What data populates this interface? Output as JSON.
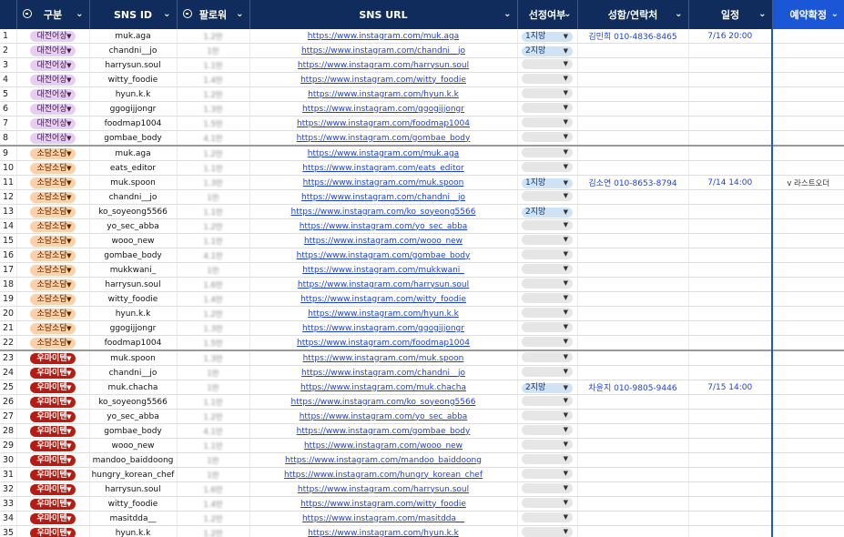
{
  "headers": {
    "category": "구분",
    "sns_id": "SNS ID",
    "followers": "팔로워",
    "url": "SNS URL",
    "selection": "선정여부",
    "contact": "성함/연락처",
    "schedule": "일정",
    "confirm": "예약확정"
  },
  "rows": [
    {
      "no": "1",
      "cat": "대전어상",
      "grp": "a",
      "id": "muk.aga",
      "fol": "1.2만",
      "url": "https://www.instagram.com/muk.aga",
      "sel": "1지망",
      "contact": "김민희 010-4836-8465",
      "date": "7/16 20:00",
      "confirm": ""
    },
    {
      "no": "2",
      "cat": "대전어상",
      "grp": "a",
      "id": "chandni__jo",
      "fol": "1만",
      "url": "https://www.instagram.com/chandni__jo",
      "sel": "2지망",
      "contact": "",
      "date": "",
      "confirm": ""
    },
    {
      "no": "3",
      "cat": "대전어상",
      "grp": "a",
      "id": "harrysun.soul",
      "fol": "1.1만",
      "url": "https://www.instagram.com/harrysun.soul",
      "sel": "",
      "contact": "",
      "date": "",
      "confirm": ""
    },
    {
      "no": "4",
      "cat": "대전어상",
      "grp": "a",
      "id": "witty_foodie",
      "fol": "1.4만",
      "url": "https://www.instagram.com/witty_foodie",
      "sel": "",
      "contact": "",
      "date": "",
      "confirm": ""
    },
    {
      "no": "5",
      "cat": "대전어상",
      "grp": "a",
      "id": "hyun.k.k",
      "fol": "1.2만",
      "url": "https://www.instagram.com/hyun.k.k",
      "sel": "",
      "contact": "",
      "date": "",
      "confirm": ""
    },
    {
      "no": "6",
      "cat": "대전어상",
      "grp": "a",
      "id": "ggogijjongr",
      "fol": "1.3만",
      "url": "https://www.instagram.com/ggogijjongr",
      "sel": "",
      "contact": "",
      "date": "",
      "confirm": ""
    },
    {
      "no": "7",
      "cat": "대전어상",
      "grp": "a",
      "id": "foodmap1004",
      "fol": "1.5만",
      "url": "https://www.instagram.com/foodmap1004",
      "sel": "",
      "contact": "",
      "date": "",
      "confirm": ""
    },
    {
      "no": "8",
      "cat": "대전어상",
      "grp": "a",
      "id": "gombae_body",
      "fol": "4.1만",
      "url": "https://www.instagram.com/gombae_body",
      "sel": "",
      "contact": "",
      "date": "",
      "confirm": ""
    },
    {
      "no": "9",
      "cat": "소담소담",
      "grp": "b",
      "id": "muk.aga",
      "fol": "1.2만",
      "url": "https://www.instagram.com/muk.aga",
      "sel": "",
      "contact": "",
      "date": "",
      "confirm": ""
    },
    {
      "no": "10",
      "cat": "소담소담",
      "grp": "b",
      "id": "eats_editor",
      "fol": "1.1만",
      "url": "https://www.instagram.com/eats_editor",
      "sel": "",
      "contact": "",
      "date": "",
      "confirm": ""
    },
    {
      "no": "11",
      "cat": "소담소담",
      "grp": "b",
      "id": "muk.spoon",
      "fol": "1.3만",
      "url": "https://www.instagram.com/muk.spoon",
      "sel": "1지망",
      "contact": "김소연 010-8653-8794",
      "date": "7/14 14:00",
      "confirm": "v 라스트오더"
    },
    {
      "no": "12",
      "cat": "소담소담",
      "grp": "b",
      "id": "chandni__jo",
      "fol": "1만",
      "url": "https://www.instagram.com/chandni__jo",
      "sel": "",
      "contact": "",
      "date": "",
      "confirm": ""
    },
    {
      "no": "13",
      "cat": "소담소담",
      "grp": "b",
      "id": "ko_soyeong5566",
      "fol": "1.1만",
      "url": "https://www.instagram.com/ko_soyeong5566",
      "sel": "2지망",
      "contact": "",
      "date": "",
      "confirm": ""
    },
    {
      "no": "14",
      "cat": "소담소담",
      "grp": "b",
      "id": "yo_sec_abba",
      "fol": "1.2만",
      "url": "https://www.instagram.com/yo_sec_abba",
      "sel": "",
      "contact": "",
      "date": "",
      "confirm": ""
    },
    {
      "no": "15",
      "cat": "소담소담",
      "grp": "b",
      "id": "wooo_new",
      "fol": "1.1만",
      "url": "https://www.instagram.com/wooo_new",
      "sel": "",
      "contact": "",
      "date": "",
      "confirm": ""
    },
    {
      "no": "16",
      "cat": "소담소담",
      "grp": "b",
      "id": "gombae_body",
      "fol": "4.1만",
      "url": "https://www.instagram.com/gombae_body",
      "sel": "",
      "contact": "",
      "date": "",
      "confirm": ""
    },
    {
      "no": "17",
      "cat": "소담소담",
      "grp": "b",
      "id": "mukkwani_",
      "fol": "1만",
      "url": "https://www.instagram.com/mukkwani_",
      "sel": "",
      "contact": "",
      "date": "",
      "confirm": ""
    },
    {
      "no": "18",
      "cat": "소담소담",
      "grp": "b",
      "id": "harrysun.soul",
      "fol": "1.6만",
      "url": "https://www.instagram.com/harrysun.soul",
      "sel": "",
      "contact": "",
      "date": "",
      "confirm": ""
    },
    {
      "no": "19",
      "cat": "소담소담",
      "grp": "b",
      "id": "witty_foodie",
      "fol": "1.4만",
      "url": "https://www.instagram.com/witty_foodie",
      "sel": "",
      "contact": "",
      "date": "",
      "confirm": ""
    },
    {
      "no": "20",
      "cat": "소담소담",
      "grp": "b",
      "id": "hyun.k.k",
      "fol": "1.2만",
      "url": "https://www.instagram.com/hyun.k.k",
      "sel": "",
      "contact": "",
      "date": "",
      "confirm": ""
    },
    {
      "no": "21",
      "cat": "소담소담",
      "grp": "b",
      "id": "ggogijjongr",
      "fol": "1.3만",
      "url": "https://www.instagram.com/ggogijjongr",
      "sel": "",
      "contact": "",
      "date": "",
      "confirm": ""
    },
    {
      "no": "22",
      "cat": "소담소담",
      "grp": "b",
      "id": "foodmap1004",
      "fol": "1.5만",
      "url": "https://www.instagram.com/foodmap1004",
      "sel": "",
      "contact": "",
      "date": "",
      "confirm": ""
    },
    {
      "no": "23",
      "cat": "우마이텐",
      "grp": "c",
      "id": "muk.spoon",
      "fol": "1.3만",
      "url": "https://www.instagram.com/muk.spoon",
      "sel": "",
      "contact": "",
      "date": "",
      "confirm": ""
    },
    {
      "no": "24",
      "cat": "우마이텐",
      "grp": "c",
      "id": "chandni__jo",
      "fol": "1만",
      "url": "https://www.instagram.com/chandni__jo",
      "sel": "",
      "contact": "",
      "date": "",
      "confirm": ""
    },
    {
      "no": "25",
      "cat": "우마이텐",
      "grp": "c",
      "id": "muk.chacha",
      "fol": "1만",
      "url": "https://www.instagram.com/muk.chacha",
      "sel": "2지망",
      "contact": "차윤지 010-9805-9446",
      "date": "7/15 14:00",
      "confirm": ""
    },
    {
      "no": "26",
      "cat": "우마이텐",
      "grp": "c",
      "id": "ko_soyeong5566",
      "fol": "1.1만",
      "url": "https://www.instagram.com/ko_soyeong5566",
      "sel": "",
      "contact": "",
      "date": "",
      "confirm": ""
    },
    {
      "no": "27",
      "cat": "우마이텐",
      "grp": "c",
      "id": "yo_sec_abba",
      "fol": "1.2만",
      "url": "https://www.instagram.com/yo_sec_abba",
      "sel": "",
      "contact": "",
      "date": "",
      "confirm": ""
    },
    {
      "no": "28",
      "cat": "우마이텐",
      "grp": "c",
      "id": "gombae_body",
      "fol": "4.1만",
      "url": "https://www.instagram.com/gombae_body",
      "sel": "",
      "contact": "",
      "date": "",
      "confirm": ""
    },
    {
      "no": "29",
      "cat": "우마이텐",
      "grp": "c",
      "id": "wooo_new",
      "fol": "1.1만",
      "url": "https://www.instagram.com/wooo_new",
      "sel": "",
      "contact": "",
      "date": "",
      "confirm": ""
    },
    {
      "no": "30",
      "cat": "우마이텐",
      "grp": "c",
      "id": "mandoo_baiddoong",
      "fol": "1만",
      "url": "https://www.instagram.com/mandoo_baiddoong",
      "sel": "",
      "contact": "",
      "date": "",
      "confirm": ""
    },
    {
      "no": "31",
      "cat": "우마이텐",
      "grp": "c",
      "id": "hungry_korean_chef",
      "fol": "1만",
      "url": "https://www.instagram.com/hungry_korean_chef",
      "sel": "",
      "contact": "",
      "date": "",
      "confirm": ""
    },
    {
      "no": "32",
      "cat": "우마이텐",
      "grp": "c",
      "id": "harrysun.soul",
      "fol": "1.6만",
      "url": "https://www.instagram.com/harrysun.soul",
      "sel": "",
      "contact": "",
      "date": "",
      "confirm": ""
    },
    {
      "no": "33",
      "cat": "우마이텐",
      "grp": "c",
      "id": "witty_foodie",
      "fol": "1.4만",
      "url": "https://www.instagram.com/witty_foodie",
      "sel": "",
      "contact": "",
      "date": "",
      "confirm": ""
    },
    {
      "no": "34",
      "cat": "우마이텐",
      "grp": "c",
      "id": "masitdda__",
      "fol": "1.2만",
      "url": "https://www.instagram.com/masitdda__",
      "sel": "",
      "contact": "",
      "date": "",
      "confirm": ""
    },
    {
      "no": "35",
      "cat": "우마이텐",
      "grp": "c",
      "id": "hyun.k.k",
      "fol": "1.2만",
      "url": "https://www.instagram.com/hyun.k.k",
      "sel": "",
      "contact": "",
      "date": "",
      "confirm": ""
    }
  ],
  "colors": {
    "header_bg": "#0f2c5c",
    "confirm_header_bg": "#1a56d6",
    "group_a": "#e8cdf2",
    "group_b": "#ffcfa6",
    "group_c": "#b51c12",
    "link": "#1f3fd6"
  },
  "icons": {
    "header_filter": "filter-circle-icon",
    "chevron": "chevron-down-icon",
    "dropdown": "dropdown-arrow-icon"
  }
}
